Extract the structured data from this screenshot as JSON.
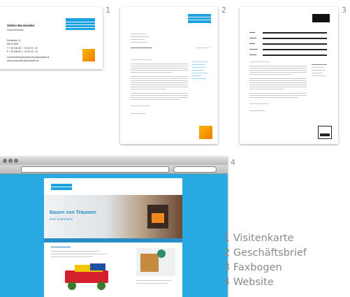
{
  "items": [
    {
      "number": "1",
      "label": "Visitenkarte"
    },
    {
      "number": "2",
      "label": "Geschäftsbrief"
    },
    {
      "number": "3",
      "label": "Faxbogen"
    },
    {
      "number": "4",
      "label": "Website"
    }
  ],
  "legend": [
    "1 Visitenkarte",
    "2 Geschäftsbrief",
    "3 Faxbogen",
    "4 Website"
  ],
  "card": {
    "name": "Stefan Besenwiler",
    "role": "Schreinermeister",
    "street": "Dorfstraße 12",
    "city": "83473 Bohl",
    "phone": "T + 49 008 65 7 - 00 00 00 - 00",
    "fax": "F + 49 008 65 7 - 00 00 00 - 00",
    "email": "s.besenwieler@schreinerei-besenwieler.de",
    "web": "www.schreinerei-besenwieler.de"
  },
  "website": {
    "hero_title": "Bauen von Träumen",
    "hero_subtitle": "Ihrer Schreinerei"
  },
  "colors": {
    "brand_blue": "#1aa3e0",
    "brand_orange": "#ef7d00",
    "label_gray": "#8a8a8a"
  }
}
